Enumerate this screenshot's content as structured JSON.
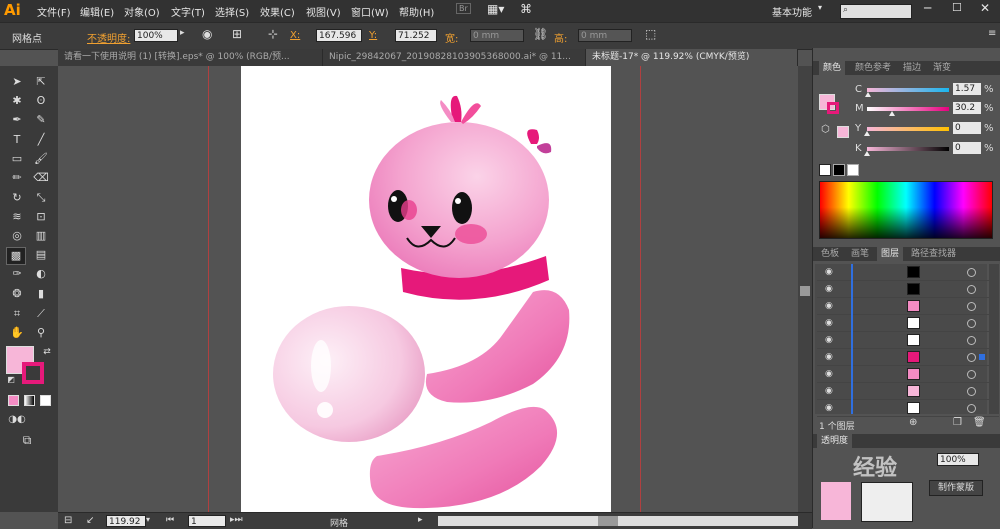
{
  "app": {
    "logo": "Ai"
  },
  "menu": [
    "文件(F)",
    "编辑(E)",
    "对象(O)",
    "文字(T)",
    "选择(S)",
    "效果(C)",
    "视图(V)",
    "窗口(W)",
    "帮助(H)"
  ],
  "menu_right": {
    "br": "Br",
    "workspace": "基本功能"
  },
  "control": {
    "label": "网格点",
    "opacity_label": "不透明度:",
    "opacity_value": "100%",
    "x_label": "X:",
    "x_value": "167.596",
    "y_label": "Y:",
    "y_value": "71.252",
    "w_label": "宽:",
    "w_value": "0 mm",
    "h_label": "高:",
    "h_value": "0 mm"
  },
  "tabs": [
    "请看一下使用说明 (1) [转换].eps* @ 100% (RGB/预...",
    "Nipic_29842067_20190828103905368000.ai* @ 11...",
    "未标题-17* @ 119.92% (CMYK/预览)"
  ],
  "color_panel": {
    "tabs": [
      "颜色",
      "颜色参考",
      "描边",
      "渐变"
    ],
    "channels": [
      {
        "name": "C",
        "value": "1.57",
        "unit": "%",
        "fraction": 0.016
      },
      {
        "name": "M",
        "value": "30.2",
        "unit": "%",
        "fraction": 0.302
      },
      {
        "name": "Y",
        "value": "0",
        "unit": "%",
        "fraction": 0
      },
      {
        "name": "K",
        "value": "0",
        "unit": "%",
        "fraction": 0
      }
    ],
    "fill_color": "#f7b6d8"
  },
  "layers_panel": {
    "tabs": [
      "色板",
      "画笔",
      "图层",
      "路径查找器"
    ],
    "footer": "1 个图层"
  },
  "bottom_panel": {
    "tab": "透明度",
    "value": "100%",
    "button": "制作蒙版",
    "watermark": "经验"
  },
  "status": {
    "zoom": "119.92",
    "page": "1",
    "tool": "网格"
  },
  "colors": {
    "accent": "#ff9a00",
    "pink": "#f48cc4",
    "magenta": "#e6197a"
  }
}
